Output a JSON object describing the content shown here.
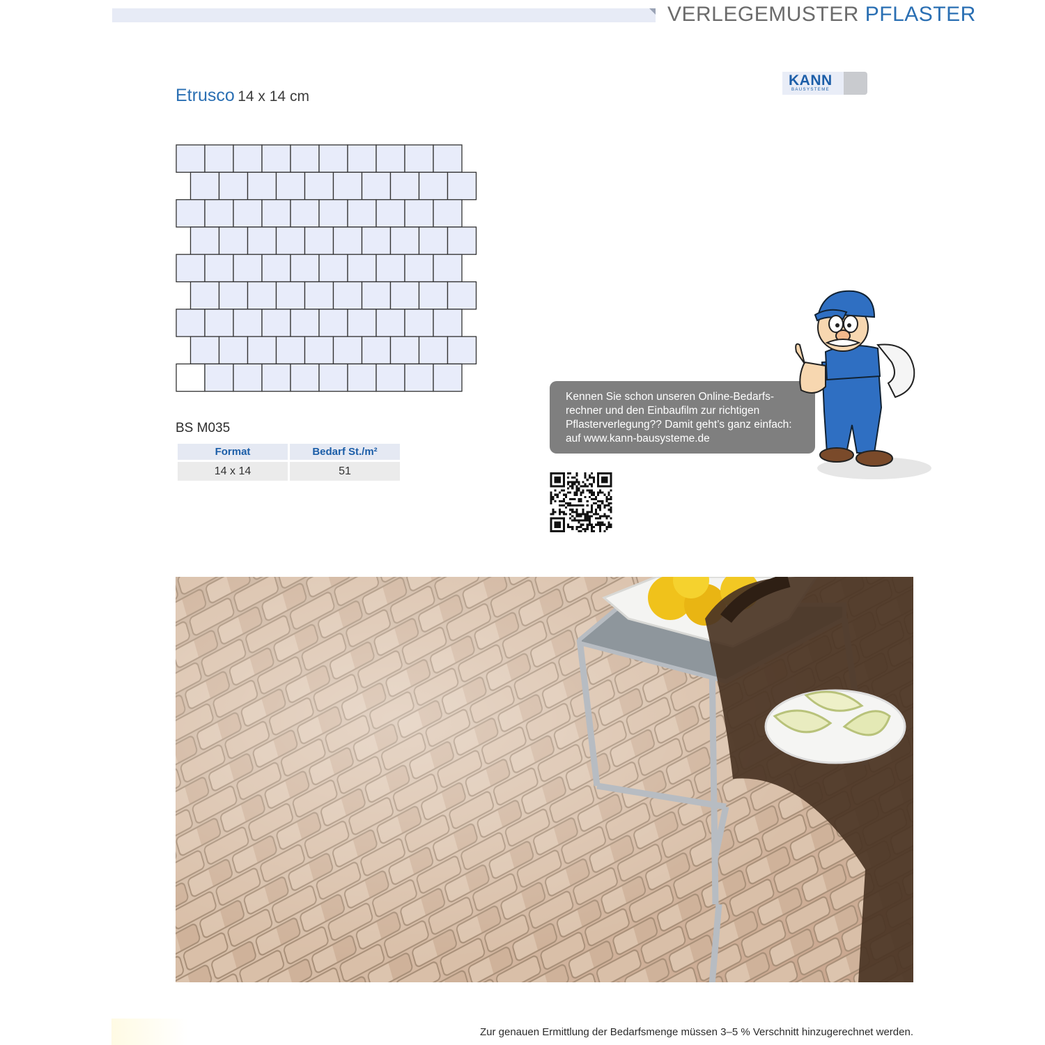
{
  "header": {
    "title_main": "VERLEGEMUSTER",
    "title_accent": "PFLASTER"
  },
  "logo": {
    "text": "KANN",
    "subtext": "BAUSYSTEME"
  },
  "product": {
    "name": "Etrusco",
    "size": "14 x 14 cm"
  },
  "pattern": {
    "rows": 9,
    "stones_per_row": 10,
    "odd_row_offset": "half stone",
    "highlighted_stone": "bottom-left"
  },
  "spec": {
    "code": "BS M035",
    "columns": [
      "Format",
      "Bedarf St./m²"
    ],
    "rows": [
      [
        "14 x 14",
        "51"
      ]
    ]
  },
  "promo": {
    "text": "Kennen Sie schon unseren Online-Bedarfs-rechner und den Einbaufilm zur richtigen Pflasterverlegung?? Damit geht’s ganz einfach: auf www.kann-bausysteme.de"
  },
  "footer": {
    "note": "Zur genauen Ermittlung der Bedarfsmenge müssen 3–5 % Verschnitt hinzugerechnet werden."
  },
  "colors": {
    "accent_blue": "#2a6fb3",
    "stone_fill": "#e8ecfa",
    "bubble_grey": "#7f7f7f"
  }
}
